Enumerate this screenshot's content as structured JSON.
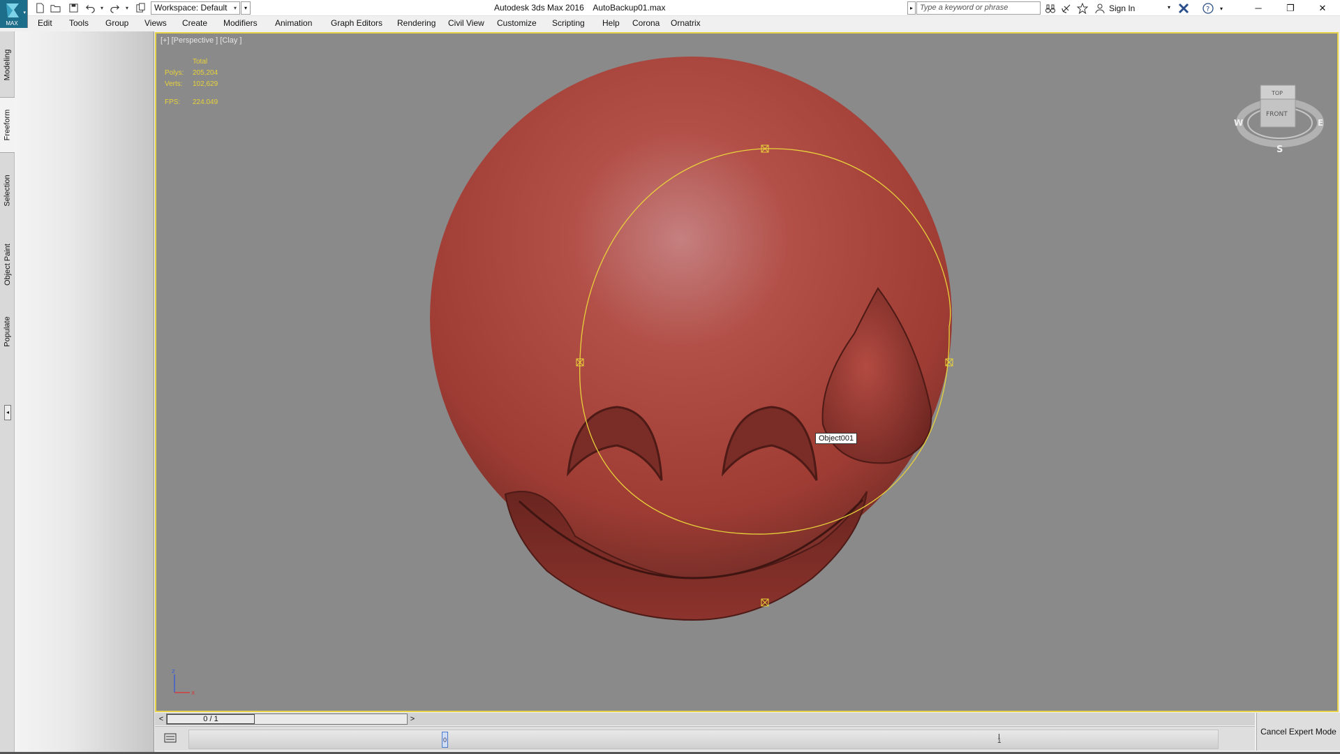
{
  "titlebar": {
    "app_logo_label": "MAX",
    "workspace": "Workspace: Default",
    "window_title": "Autodesk 3ds Max 2016    AutoBackup01.max",
    "search_placeholder": "Type a keyword or phrase",
    "sign_in": "Sign In"
  },
  "menu": {
    "items": [
      "Edit",
      "Tools",
      "Group",
      "Views",
      "Create",
      "Modifiers",
      "Animation",
      "Graph Editors",
      "Rendering",
      "Civil View",
      "Customize",
      "Scripting",
      "Help",
      "Corona",
      "Ornatrix"
    ]
  },
  "left_tabs": [
    "Modeling",
    "Freeform",
    "Selection",
    "Object Paint",
    "Populate"
  ],
  "active_left_tab": "Freeform",
  "viewport": {
    "label": "[+] [Perspective ] [Clay ]",
    "stats": {
      "header": "Total",
      "polys_label": "Polys:",
      "polys": "205,204",
      "verts_label": "Verts:",
      "verts": "102,629",
      "fps_label": "FPS:",
      "fps": "224.049"
    },
    "tooltip": "Object001",
    "viewcube": {
      "top": "TOP",
      "front": "FRONT",
      "w": "W",
      "e": "E",
      "s": "S"
    },
    "axis": {
      "z": "z",
      "x": "x"
    },
    "border_color": "#e7d24a",
    "object_color": "#b5453b",
    "selection_gizmo_color": "#e8d23a"
  },
  "timeline": {
    "prev": "<",
    "next": ">",
    "slider": "0 / 1",
    "frame_marker": "0",
    "tick_label": "1"
  },
  "status": {
    "cancel_expert": "Cancel Expert Mode"
  }
}
